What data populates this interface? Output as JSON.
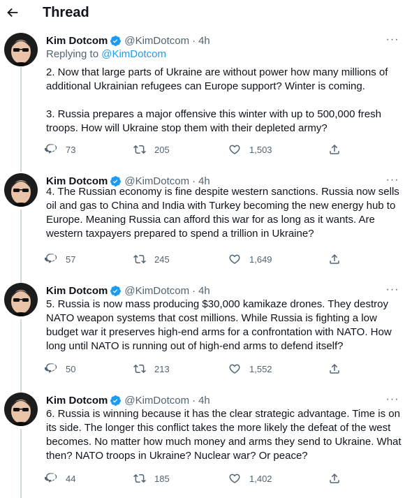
{
  "header": {
    "title": "Thread"
  },
  "tweets": [
    {
      "name": "Kim Dotcom",
      "handle": "@KimDotcom",
      "separator": "·",
      "time": "4h",
      "replying_prefix": "Replying to ",
      "replying_to": "@KimDotcom",
      "text": "2. Now that large parts of Ukraine are without power how many millions of additional Ukrainian refugees can Europe support? Winter is coming.\n\n3. Russia prepares a major offensive this winter with up to 500,000 fresh troops. How will Ukraine stop them with their depleted army?",
      "replies": "73",
      "retweets": "205",
      "likes": "1,503"
    },
    {
      "name": "Kim Dotcom",
      "handle": "@KimDotcom",
      "separator": "·",
      "time": "4h",
      "text": "4. The Russian economy is fine despite western sanctions. Russia now sells oil and gas to China and India with Turkey becoming the new energy hub to Europe. Meaning Russia can afford this war for as long as it wants. Are western taxpayers prepared to spend a trillion in Ukraine?",
      "replies": "57",
      "retweets": "245",
      "likes": "1,649"
    },
    {
      "name": "Kim Dotcom",
      "handle": "@KimDotcom",
      "separator": "·",
      "time": "4h",
      "text": "5. Russia is now mass producing $30,000 kamikaze drones. They destroy NATO weapon systems that cost millions. While Russia is fighting a low budget war it preserves high-end arms for a confrontation with NATO. How long until NATO is running out of high-end arms to defend itself?",
      "replies": "50",
      "retweets": "213",
      "likes": "1,552"
    },
    {
      "name": "Kim Dotcom",
      "handle": "@KimDotcom",
      "separator": "·",
      "time": "4h",
      "text": "6. Russia is winning because it has the clear strategic advantage. Time is on its side. The longer this conflict takes the more likely the defeat of the west becomes. No matter how much money and arms they send to Ukraine. What then? NATO troops in Ukraine? Nuclear war? Or peace?",
      "replies": "44",
      "retweets": "185",
      "likes": "1,402"
    }
  ],
  "icons": {
    "back": "arrow-left-icon",
    "verified": "verified-badge-icon",
    "more": "more-icon",
    "reply": "reply-icon",
    "retweet": "retweet-icon",
    "like": "heart-icon",
    "share": "share-icon"
  },
  "colors": {
    "text": "#0f1419",
    "secondary": "#536471",
    "link": "#1d9bf0",
    "verified": "#1d9bf0",
    "thread_line": "#cfd9de"
  }
}
